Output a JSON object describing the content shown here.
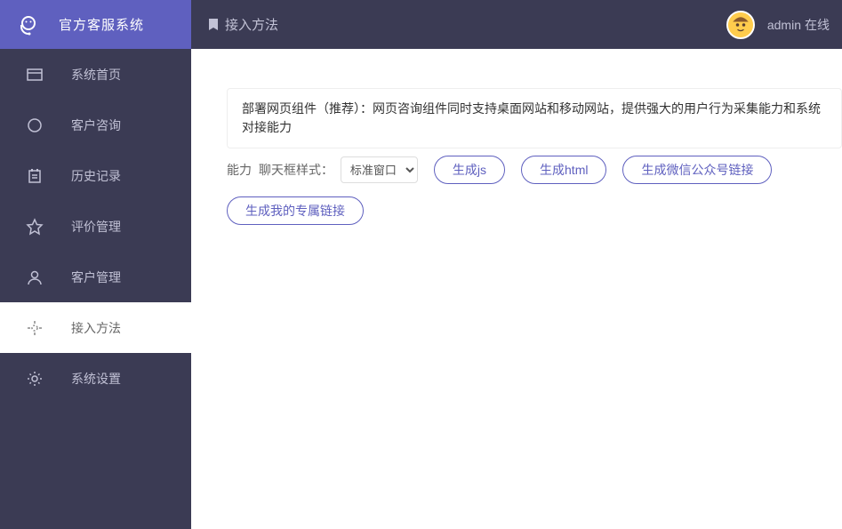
{
  "app": {
    "name": "官方客服系统"
  },
  "header": {
    "page_title": "接入方法",
    "user_name": "admin",
    "user_status": "在线"
  },
  "sidebar": {
    "items": [
      {
        "label": "系统首页"
      },
      {
        "label": "客户咨询"
      },
      {
        "label": "历史记录"
      },
      {
        "label": "评价管理"
      },
      {
        "label": "客户管理"
      },
      {
        "label": "接入方法"
      },
      {
        "label": "系统设置"
      }
    ]
  },
  "main": {
    "info_text": "部署网页组件（推荐）：网页咨询组件同时支持桌面网站和移动网站，提供强大的用户行为采集能力和系统对接能力",
    "trailing_info": "能力",
    "style_label": "聊天框样式：",
    "style_options": [
      "标准窗口"
    ],
    "style_selected": "标准窗口",
    "buttons": {
      "gen_js": "生成js",
      "gen_html": "生成html",
      "gen_wechat": "生成微信公众号链接",
      "gen_mine": "生成我的专属链接"
    }
  }
}
